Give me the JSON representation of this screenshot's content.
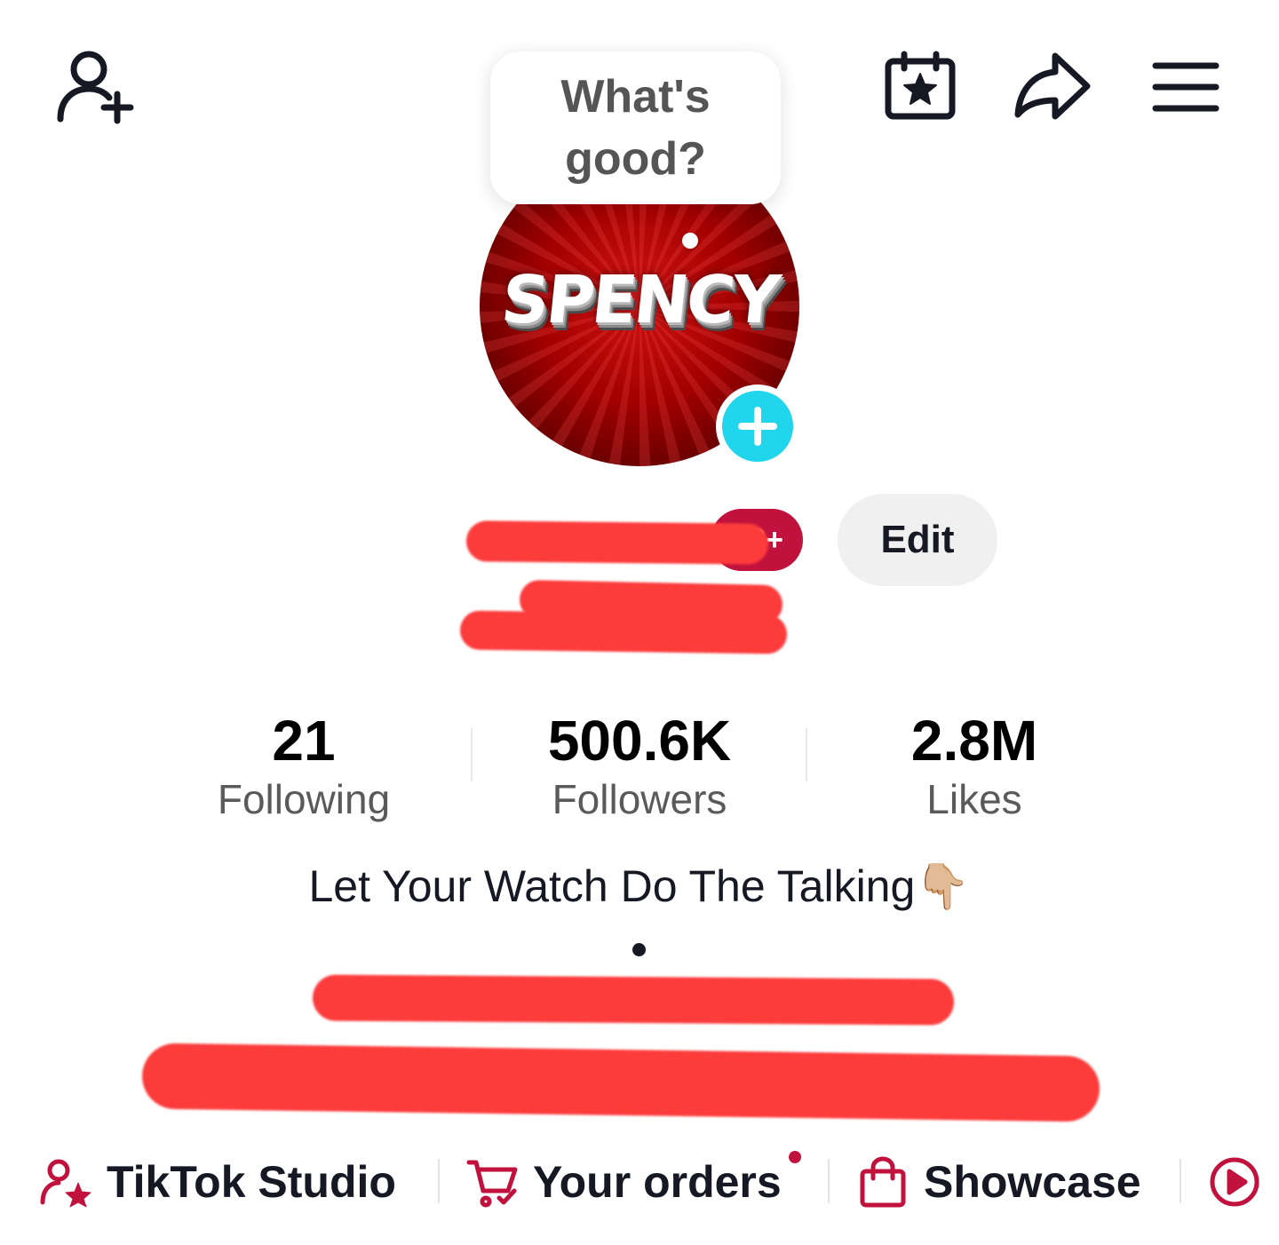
{
  "top_bar": {
    "icons": [
      "add-friend-icon",
      "calendar-star-icon",
      "share-icon",
      "menu-icon"
    ]
  },
  "tooltip": {
    "text": "What's good?"
  },
  "avatar": {
    "logo_text": "SPENCY"
  },
  "profile": {
    "badge_label": "2+",
    "edit_label": "Edit"
  },
  "stats": [
    {
      "value": "21",
      "label": "Following"
    },
    {
      "value": "500.6K",
      "label": "Followers"
    },
    {
      "value": "2.8M",
      "label": "Likes"
    }
  ],
  "bio": {
    "line1": "Let Your Watch Do The Talking👇🏼"
  },
  "tools": [
    {
      "label": "TikTok Studio",
      "icon": "creator-star-icon"
    },
    {
      "label": "Your orders",
      "icon": "cart-icon"
    },
    {
      "label": "Showcase",
      "icon": "shopping-bag-icon"
    }
  ],
  "colors": {
    "accent": "#c1123d",
    "avatar_plus": "#20d5ec",
    "redaction": "#fc3b3b",
    "edit_bg": "#f0f0f0"
  }
}
